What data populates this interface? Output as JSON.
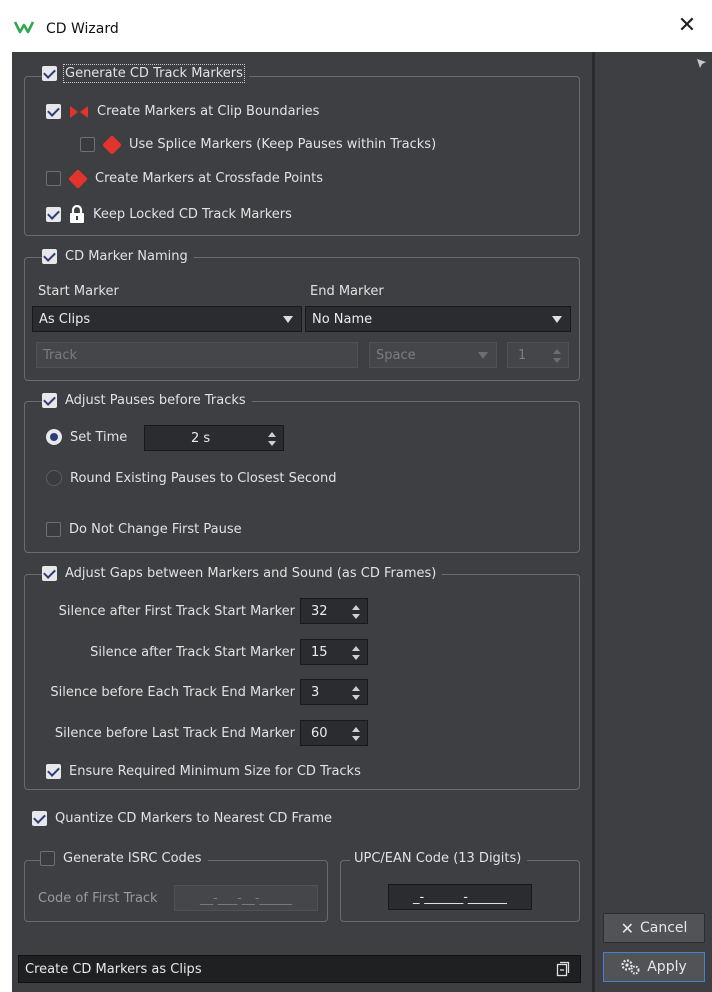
{
  "window": {
    "title": "CD Wizard",
    "close_symbol": "✕"
  },
  "track_markers": {
    "header": "Generate CD Track Markers",
    "header_checked": true,
    "clip_boundaries": "Create Markers at Clip Boundaries",
    "splice": "Use Splice Markers (Keep Pauses within Tracks)",
    "crossfade": "Create Markers at Crossfade Points",
    "locked": "Keep Locked CD Track Markers"
  },
  "naming": {
    "header": "CD Marker Naming",
    "start_label": "Start Marker",
    "start_value": "As Clips",
    "end_label": "End Marker",
    "end_value": "No Name",
    "name_field": "Track",
    "separator": "Space",
    "number": "1"
  },
  "pauses": {
    "header": "Adjust Pauses before Tracks",
    "set_time_label": "Set Time",
    "set_time_value": "2 s",
    "round_label": "Round Existing Pauses to Closest Second",
    "first_pause_label": "Do Not Change First Pause"
  },
  "gaps": {
    "header": "Adjust Gaps between Markers and Sound (as CD Frames)",
    "rows": [
      {
        "label": "Silence after First Track Start Marker",
        "value": "32"
      },
      {
        "label": "Silence after Track Start Marker",
        "value": "15"
      },
      {
        "label": "Silence before Each Track End Marker",
        "value": "3"
      },
      {
        "label": "Silence before Last Track End Marker",
        "value": "60"
      }
    ],
    "ensure_label": "Ensure Required Minimum Size for CD Tracks"
  },
  "quantize_label": "Quantize CD Markers to Nearest CD Frame",
  "isrc": {
    "header": "Generate ISRC Codes",
    "first_label": "Code of First Track",
    "first_value": "__-___-__-_____"
  },
  "upc": {
    "header": "UPC/EAN Code (13 Digits)",
    "value": "_-______-______"
  },
  "buttons": {
    "cancel": "Cancel",
    "apply": "Apply"
  },
  "status": {
    "text": "Create CD Markers as Clips"
  },
  "colors": {
    "panel": "#3e3f43",
    "accent": "#4a7fd6",
    "marker_red": "#e0342c"
  }
}
